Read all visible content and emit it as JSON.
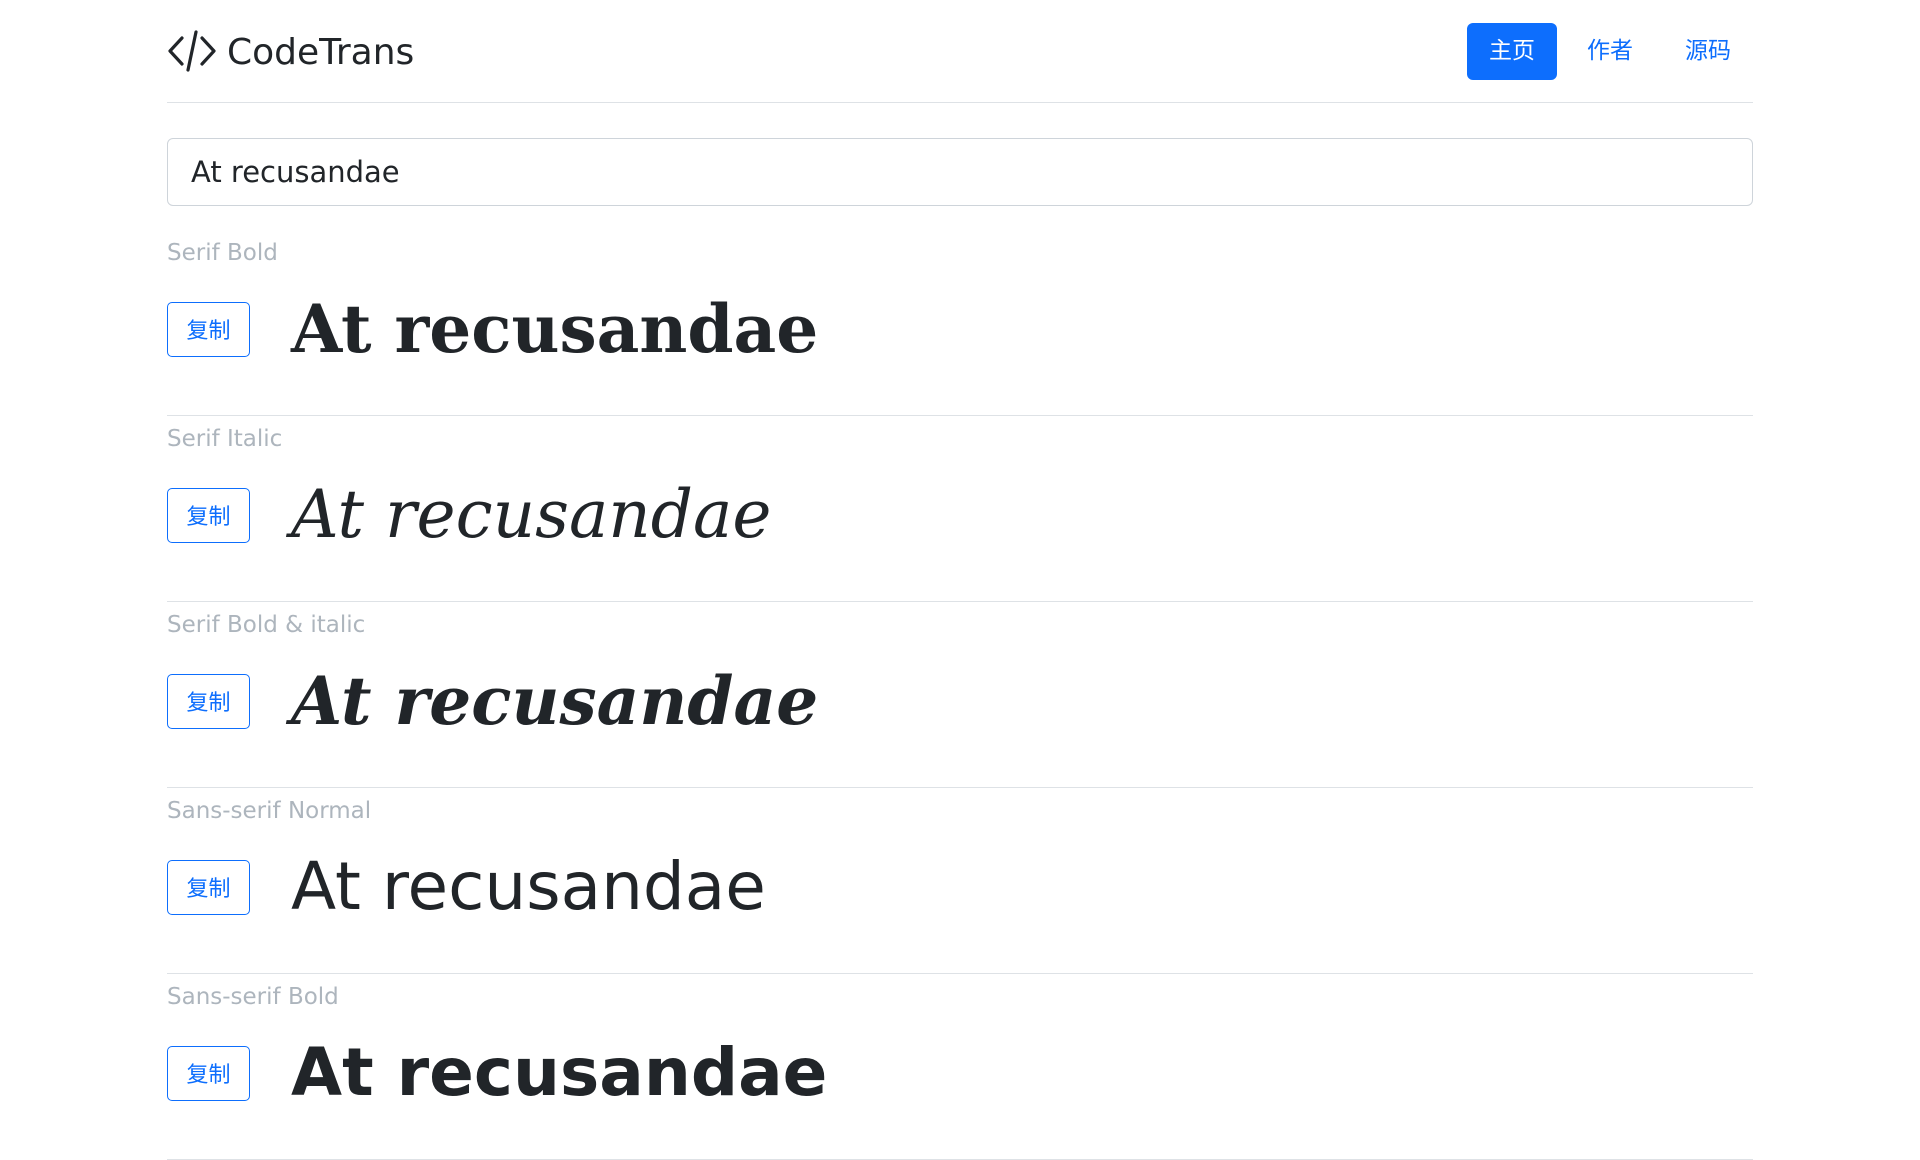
{
  "header": {
    "brand": "CodeTrans",
    "brand_icon": "code-icon",
    "nav": {
      "home": "主页",
      "author": "作者",
      "source": "源码"
    },
    "accent_color": "#0d6efd"
  },
  "search": {
    "value": "At recusandae"
  },
  "items": [
    {
      "label": "Serif Bold",
      "copy": "复制",
      "sample": "At recusandae"
    },
    {
      "label": "Serif Italic",
      "copy": "复制",
      "sample": "At recusandae"
    },
    {
      "label": "Serif Bold & italic",
      "copy": "复制",
      "sample": "At recusandae"
    },
    {
      "label": "Sans-serif Normal",
      "copy": "复制",
      "sample": "At recusandae"
    },
    {
      "label": "Sans-serif Bold",
      "copy": "复制",
      "sample": "At recusandae"
    }
  ]
}
